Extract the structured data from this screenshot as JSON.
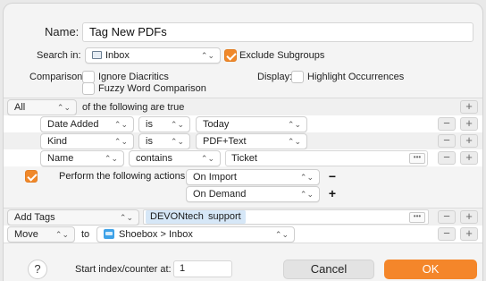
{
  "header": {
    "name_label": "Name:",
    "name_value": "Tag New PDFs",
    "search_in_label": "Search in:",
    "search_in_value": "Inbox",
    "exclude_subgroups_label": "Exclude Subgroups",
    "exclude_subgroups_checked": true,
    "comparison_label": "Comparison:",
    "ignore_diacritics_label": "Ignore Diacritics",
    "fuzzy_word_label": "Fuzzy Word Comparison",
    "display_label": "Display:",
    "highlight_label": "Highlight Occurrences"
  },
  "conditions": {
    "match_mode": "All",
    "match_suffix": "of the following are true",
    "rows": [
      {
        "field": "Date Added",
        "operator": "is",
        "value": "Today"
      },
      {
        "field": "Kind",
        "operator": "is",
        "value": "PDF+Text"
      },
      {
        "field": "Name",
        "operator": "contains",
        "value": "Ticket"
      }
    ]
  },
  "perform": {
    "checked": true,
    "label": "Perform the following actions:",
    "events": [
      "On Import",
      "On Demand"
    ]
  },
  "actions": {
    "add_tags_label": "Add Tags",
    "tags": [
      "DEVONtech",
      "support"
    ],
    "move_label": "Move",
    "to_label": "to",
    "move_target": "Shoebox > Inbox"
  },
  "footer": {
    "help_label": "?",
    "start_index_label": "Start index/counter at:",
    "start_index_value": "1",
    "cancel_label": "Cancel",
    "ok_label": "OK"
  },
  "glyphs": {
    "chevron": "⌃⌄",
    "plus": "+",
    "minus": "−",
    "ellipsis": "•••"
  },
  "colors": {
    "accent": "#f4862a",
    "token_bg": "#d6e7f7"
  }
}
